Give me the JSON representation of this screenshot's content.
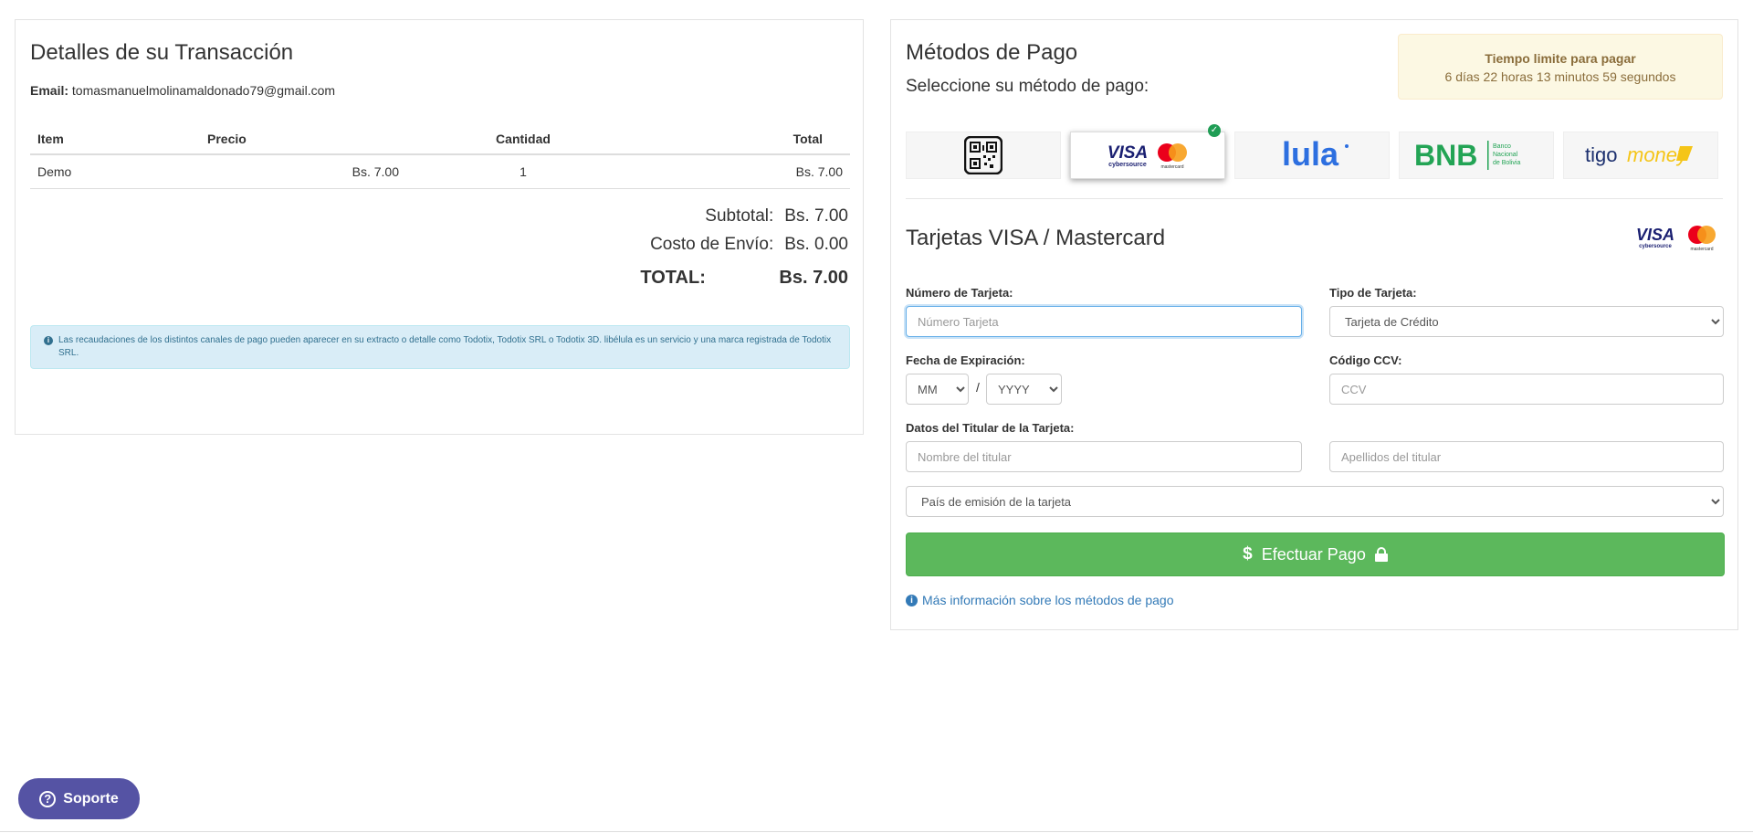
{
  "transaction": {
    "title": "Detalles de su Transacción",
    "email_label": "Email:",
    "email": "tomasmanuelmolinamaldonado79@gmail.com",
    "columns": [
      "Item",
      "Precio",
      "Cantidad",
      "Total"
    ],
    "rows": [
      {
        "item": "Demo",
        "precio": "Bs. 7.00",
        "cantidad": "1",
        "total": "Bs. 7.00"
      }
    ],
    "subtotal_label": "Subtotal:",
    "subtotal": "Bs. 7.00",
    "envio_label": "Costo de Envío:",
    "envio": "Bs. 0.00",
    "total_label": "TOTAL:",
    "total": "Bs. 7.00",
    "notice": "Las recaudaciones de los distintos canales de pago pueden aparecer en su extracto o detalle como Todotix, Todotix SRL o Todotix 3D. libélula es un servicio y una marca registrada de Todotix SRL."
  },
  "payment": {
    "title": "Métodos de Pago",
    "subtitle": "Seleccione su método de pago:",
    "timer_title": "Tiempo limite para pagar",
    "timer_value": "6 días 22 horas 13 minutos 59 segundos",
    "methods": [
      {
        "name": "QR",
        "selected": false
      },
      {
        "name": "VISA / Mastercard",
        "selected": true
      },
      {
        "name": "lula",
        "selected": false
      },
      {
        "name": "BNB",
        "selected": false
      },
      {
        "name": "tigo money",
        "selected": false
      }
    ],
    "logo_text": {
      "visa": "VISA",
      "cybersource": "cybersource",
      "mastercard": "mastercard",
      "lula": "lula",
      "bnb": "BNB",
      "bnb_line1": "Banco",
      "bnb_line2": "Nacional",
      "bnb_line3": "de Bolivia",
      "tigo": "tigo",
      "money": "money"
    },
    "card_section_title": "Tarjetas VISA / Mastercard",
    "card_number_label": "Número de Tarjeta:",
    "card_number_placeholder": "Número Tarjeta",
    "card_type_label": "Tipo de Tarjeta:",
    "card_type_value": "Tarjeta de Crédito",
    "expiry_label": "Fecha de Expiración:",
    "expiry_month": "MM",
    "expiry_year": "YYYY",
    "expiry_sep": "/",
    "ccv_label": "Código CCV:",
    "ccv_placeholder": "CCV",
    "holder_label": "Datos del Titular de la Tarjeta:",
    "holder_name_placeholder": "Nombre del titular",
    "holder_surname_placeholder": "Apellidos del titular",
    "country_value": "País de emisión de la tarjeta",
    "pay_button": "Efectuar Pago",
    "more_info": "Más información sobre los métodos de pago"
  },
  "support": {
    "label": "Soporte"
  },
  "colors": {
    "primary_green": "#5cb85c",
    "link_blue": "#337ab7",
    "support_purple": "#5553a4",
    "visa_blue": "#1a1f71"
  }
}
